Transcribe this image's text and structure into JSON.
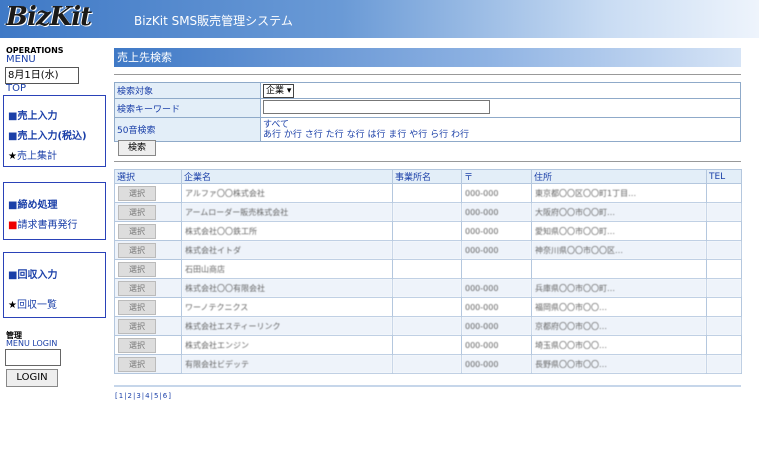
{
  "header": {
    "logo": "BizKit",
    "title": "BizKit SMS販売管理システム"
  },
  "sidebar": {
    "operations": "OPERATIONS",
    "menu": "MENU",
    "date": "8月1日(水)",
    "top": "TOP",
    "group1": [
      {
        "prefix": "■",
        "label": "売上入力"
      },
      {
        "prefix": "■",
        "label": "売上入力(税込)"
      },
      {
        "prefix": "★",
        "label": "売上集計"
      }
    ],
    "group2": [
      {
        "prefix": "■",
        "label": "締め処理"
      },
      {
        "prefix": "■",
        "label": "請求書再発行"
      }
    ],
    "group3": [
      {
        "prefix": "■",
        "label": "回収入力"
      },
      {
        "prefix": "★",
        "label": "回収一覧"
      }
    ],
    "admin": "管理",
    "menu_login": "MENU LOGIN",
    "login_button": "LOGIN"
  },
  "main": {
    "page_title": "売上先検索",
    "search": {
      "target_label": "検索対象",
      "target_value": "企業",
      "keyword_label": "検索キーワード",
      "keyword_value": "",
      "kana_label": "50音検索",
      "kana_all": "すべて",
      "kana_rows": [
        "あ行",
        "か行",
        "さ行",
        "た行",
        "な行",
        "は行",
        "ま行",
        "や行",
        "ら行",
        "わ行"
      ],
      "search_button": "検索"
    },
    "results": {
      "columns": [
        "選択",
        "企業名",
        "事業所名",
        "〒",
        "住所",
        "TEL"
      ],
      "select_label": "選択",
      "rows": [
        {
          "company": "アルファ〇〇株式会社",
          "office": "",
          "zip": "000-000",
          "address": "東京都〇〇区〇〇町1丁目…",
          "tel": ""
        },
        {
          "company": "アームローダー販売株式会社",
          "office": "",
          "zip": "000-000",
          "address": "大阪府〇〇市〇〇町…",
          "tel": ""
        },
        {
          "company": "株式会社〇〇鉄工所",
          "office": "",
          "zip": "000-000",
          "address": "愛知県〇〇市〇〇町…",
          "tel": ""
        },
        {
          "company": "株式会社イトダ",
          "office": "",
          "zip": "000-000",
          "address": "神奈川県〇〇市〇〇区…",
          "tel": ""
        },
        {
          "company": "石田山商店",
          "office": "",
          "zip": "",
          "address": "",
          "tel": ""
        },
        {
          "company": "株式会社〇〇有限会社",
          "office": "",
          "zip": "000-000",
          "address": "兵庫県〇〇市〇〇町…",
          "tel": ""
        },
        {
          "company": "ワーノテクニクス",
          "office": "",
          "zip": "000-000",
          "address": "福岡県〇〇市〇〇…",
          "tel": ""
        },
        {
          "company": "株式会社エスティーリンク",
          "office": "",
          "zip": "000-000",
          "address": "京都府〇〇市〇〇…",
          "tel": ""
        },
        {
          "company": "株式会社エンジン",
          "office": "",
          "zip": "000-000",
          "address": "埼玉県〇〇市〇〇…",
          "tel": ""
        },
        {
          "company": "有限会社ビデッテ",
          "office": "",
          "zip": "000-000",
          "address": "長野県〇〇市〇〇…",
          "tel": ""
        }
      ]
    },
    "pager": "[1|2|3|4|5|6]"
  }
}
